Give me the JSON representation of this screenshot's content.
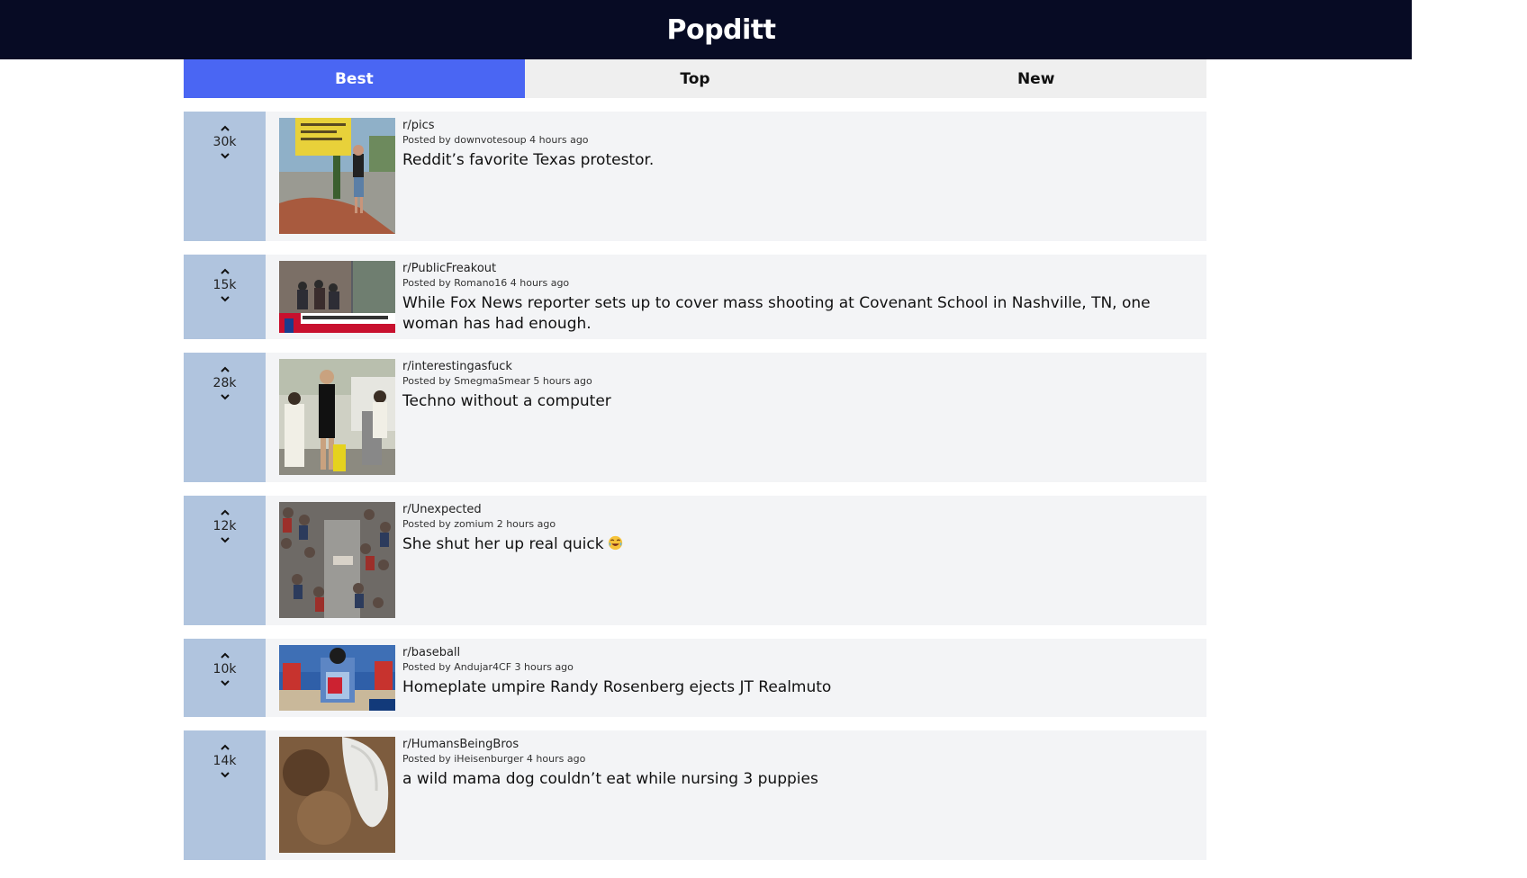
{
  "app": {
    "title": "Popditt"
  },
  "tabs": [
    {
      "label": "Best",
      "active": true
    },
    {
      "label": "Top",
      "active": false
    },
    {
      "label": "New",
      "active": false
    }
  ],
  "posts": [
    {
      "score": "30k",
      "subreddit": "r/pics",
      "posted": "Posted by downvotesoup 4 hours ago",
      "title": "Reddit’s favorite Texas protestor."
    },
    {
      "score": "15k",
      "subreddit": "r/PublicFreakout",
      "posted": "Posted by Romano16 4 hours ago",
      "title": "While Fox News reporter sets up to cover mass shooting at Covenant School in Nashville, TN, one woman has had enough."
    },
    {
      "score": "28k",
      "subreddit": "r/interestingasfuck",
      "posted": "Posted by SmegmaSmear 5 hours ago",
      "title": "Techno without a computer"
    },
    {
      "score": "12k",
      "subreddit": "r/Unexpected",
      "posted": "Posted by zomium 2 hours ago",
      "title": "She shut her up real quick"
    },
    {
      "score": "10k",
      "subreddit": "r/baseball",
      "posted": "Posted by Andujar4CF 3 hours ago",
      "title": "Homeplate umpire Randy Rosenberg ejects JT Realmuto"
    },
    {
      "score": "14k",
      "subreddit": "r/HumansBeingBros",
      "posted": "Posted by iHeisenburger 4 hours ago",
      "title": "a wild mama dog couldn’t eat while nursing 3 puppies"
    }
  ],
  "colors": {
    "header_bg": "#070b24",
    "active_tab": "#4a66f3",
    "vote_column": "#b0c4de",
    "post_bg": "#f3f4f6"
  },
  "icons": {
    "upvote": "chevron-up-icon",
    "downvote": "chevron-down-icon",
    "emoji": "laughing-face-emoji-icon"
  }
}
